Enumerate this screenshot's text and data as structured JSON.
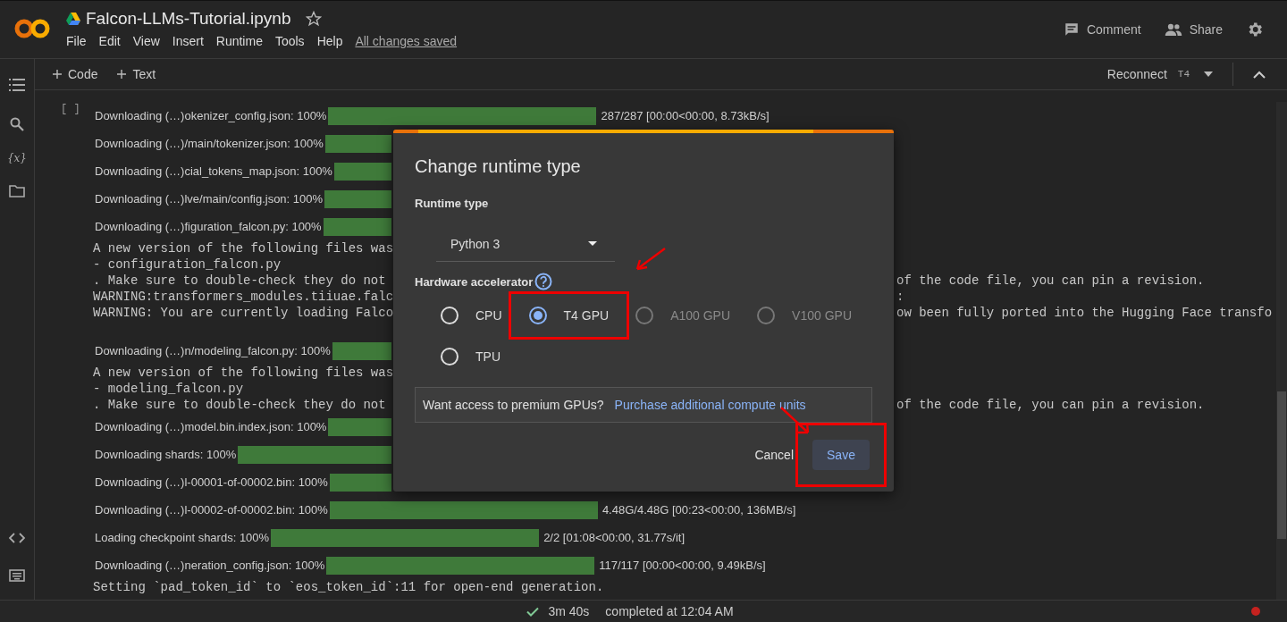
{
  "header": {
    "title": "Falcon-LLMs-Tutorial.ipynb",
    "starred": false,
    "menu": [
      "File",
      "Edit",
      "View",
      "Insert",
      "Runtime",
      "Tools",
      "Help"
    ],
    "save_status": "All changes saved",
    "actions": [
      {
        "kind": "comment",
        "label": "Comment"
      },
      {
        "kind": "share",
        "label": "Share"
      }
    ]
  },
  "sidebar": {
    "variables_glyph": "{x}"
  },
  "toolbar": {
    "add_buttons": [
      "Code",
      "Text"
    ],
    "runtime_label": "Reconnect",
    "accelerator": "T4"
  },
  "cell": {
    "bracket": "[ ]",
    "output": [
      {
        "kind": "progress",
        "label": "Downloading (…)okenizer_config.json: 100%",
        "level": 1,
        "stats": "287/287 [00:00<00:00, 8.73kB/s]"
      },
      {
        "kind": "progress",
        "label": "Downloading (…)/main/tokenizer.json: 100%",
        "level": 1
      },
      {
        "kind": "progress",
        "label": "Downloading (…)cial_tokens_map.json: 100%",
        "level": 1
      },
      {
        "kind": "progress",
        "label": "Downloading (…)lve/main/config.json: 100%",
        "level": 1
      },
      {
        "kind": "progress",
        "label": "Downloading (…)figuration_falcon.py: 100%",
        "level": 1
      },
      {
        "kind": "text",
        "left": "A new version of the following files was"
      },
      {
        "kind": "text",
        "left": "- configuration_falcon.py"
      },
      {
        "kind": "text",
        "left": ". Make sure to double-check they do not",
        "right": "of the code file, you can pin a revision."
      },
      {
        "kind": "text",
        "left": "WARNING:transformers_modules.tiiuae.falc",
        "right": ":"
      },
      {
        "kind": "text",
        "left": "WARNING: You are currently loading Falco",
        "right": "ow been fully ported into the Hugging Face transfo"
      },
      {
        "kind": "gap"
      },
      {
        "kind": "progress",
        "label": "Downloading (…)n/modeling_falcon.py: 100%",
        "level": 1
      },
      {
        "kind": "text",
        "left": "A new version of the following files was"
      },
      {
        "kind": "text",
        "left": "- modeling_falcon.py"
      },
      {
        "kind": "text",
        "left": ". Make sure to double-check they do not",
        "right": "of the code file, you can pin a revision."
      },
      {
        "kind": "progress",
        "label": "Downloading (…)model.bin.index.json: 100%",
        "level": 1
      },
      {
        "kind": "progress",
        "label": "Downloading shards: 100%",
        "level": 1
      },
      {
        "kind": "progress",
        "label": "Downloading (…)l-00001-of-00002.bin: 100%",
        "level": 1
      },
      {
        "kind": "progress",
        "label": "Downloading (…)l-00002-of-00002.bin: 100%",
        "level": 1,
        "stats": "4.48G/4.48G [00:23<00:00, 136MB/s]"
      },
      {
        "kind": "progress",
        "label": "Loading checkpoint shards: 100%",
        "level": 1,
        "stats": "2/2 [01:08<00:00, 31.77s/it]"
      },
      {
        "kind": "progress",
        "label": "Downloading (…)neration_config.json: 100%",
        "level": 1,
        "stats": "117/117 [00:00<00:00, 9.49kB/s]"
      },
      {
        "kind": "text",
        "left": "Setting `pad_token_id` to `eos_token_id`:11 for open-end generation."
      }
    ]
  },
  "dialog": {
    "title": "Change runtime type",
    "runtime_heading": "Runtime type",
    "runtime_value": "Python 3",
    "accelerator_heading": "Hardware accelerator",
    "options": [
      {
        "label": "CPU",
        "selected": false,
        "disabled": false,
        "highlighted": false
      },
      {
        "label": "T4 GPU",
        "selected": true,
        "disabled": false,
        "highlighted": true
      },
      {
        "label": "A100 GPU",
        "selected": false,
        "disabled": true,
        "highlighted": false
      },
      {
        "label": "V100 GPU",
        "selected": false,
        "disabled": true,
        "highlighted": false
      },
      {
        "label": "TPU",
        "selected": false,
        "disabled": false,
        "highlighted": false
      }
    ],
    "promo_text": "Want access to premium GPUs?",
    "promo_link": "Purchase additional compute units",
    "cancel": "Cancel",
    "save": "Save",
    "save_highlighted": true
  },
  "status_bar": {
    "duration": "3m 40s",
    "message": "completed at 12:04 AM"
  }
}
